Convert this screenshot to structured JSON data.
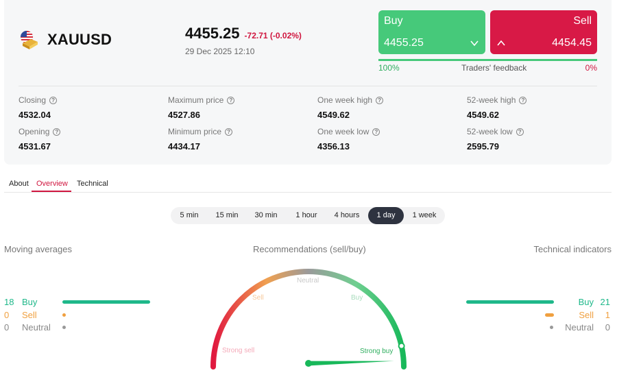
{
  "instrument": {
    "symbol": "XAUUSD",
    "price": "4455.25",
    "change": "-72.71 (-0.02%)",
    "datetime": "29 Dec 2025 12:10"
  },
  "trade": {
    "buy_label": "Buy",
    "buy_price": "4455.25",
    "sell_label": "Sell",
    "sell_price": "4454.45",
    "feedback_label": "Traders' feedback",
    "feedback_buy_pct": "100%",
    "feedback_sell_pct": "0%",
    "feedback_buy_fraction": 1.0
  },
  "stats": [
    {
      "label": "Closing",
      "value": "4532.04"
    },
    {
      "label": "Maximum price",
      "value": "4527.86"
    },
    {
      "label": "One week high",
      "value": "4549.62"
    },
    {
      "label": "52-week high",
      "value": "4549.62"
    },
    {
      "label": "Opening",
      "value": "4531.67"
    },
    {
      "label": "Minimum price",
      "value": "4434.17"
    },
    {
      "label": "One week low",
      "value": "4356.13"
    },
    {
      "label": "52-week low",
      "value": "2595.79"
    }
  ],
  "tabs": [
    "About",
    "Overview",
    "Technical"
  ],
  "active_tab": "Overview",
  "periods": [
    "5 min",
    "15 min",
    "30 min",
    "1 hour",
    "4 hours",
    "1 day",
    "1 week"
  ],
  "active_period": "1 day",
  "moving_averages": {
    "title": "Moving averages",
    "buy": {
      "count": "18",
      "label": "Buy"
    },
    "sell": {
      "count": "0",
      "label": "Sell"
    },
    "neutral": {
      "count": "0",
      "label": "Neutral"
    }
  },
  "recommendations": {
    "title": "Recommendations (sell/buy)",
    "labels": {
      "strong_sell": "Strong sell",
      "sell": "Sell",
      "neutral": "Neutral",
      "buy": "Buy",
      "strong_buy": "Strong buy"
    },
    "needle_value": 0.93
  },
  "technical_indicators": {
    "title": "Technical indicators",
    "buy": {
      "count": "21",
      "label": "Buy"
    },
    "sell": {
      "count": "1",
      "label": "Sell"
    },
    "neutral": {
      "count": "0",
      "label": "Neutral"
    }
  },
  "colors": {
    "buy": "#46c97a",
    "sell": "#d81946",
    "ma_buy": "#1fb88a",
    "ma_sell": "#f0a040",
    "neutral": "#999999",
    "active_tab": "#d0163f",
    "active_period": "#2e3340"
  }
}
